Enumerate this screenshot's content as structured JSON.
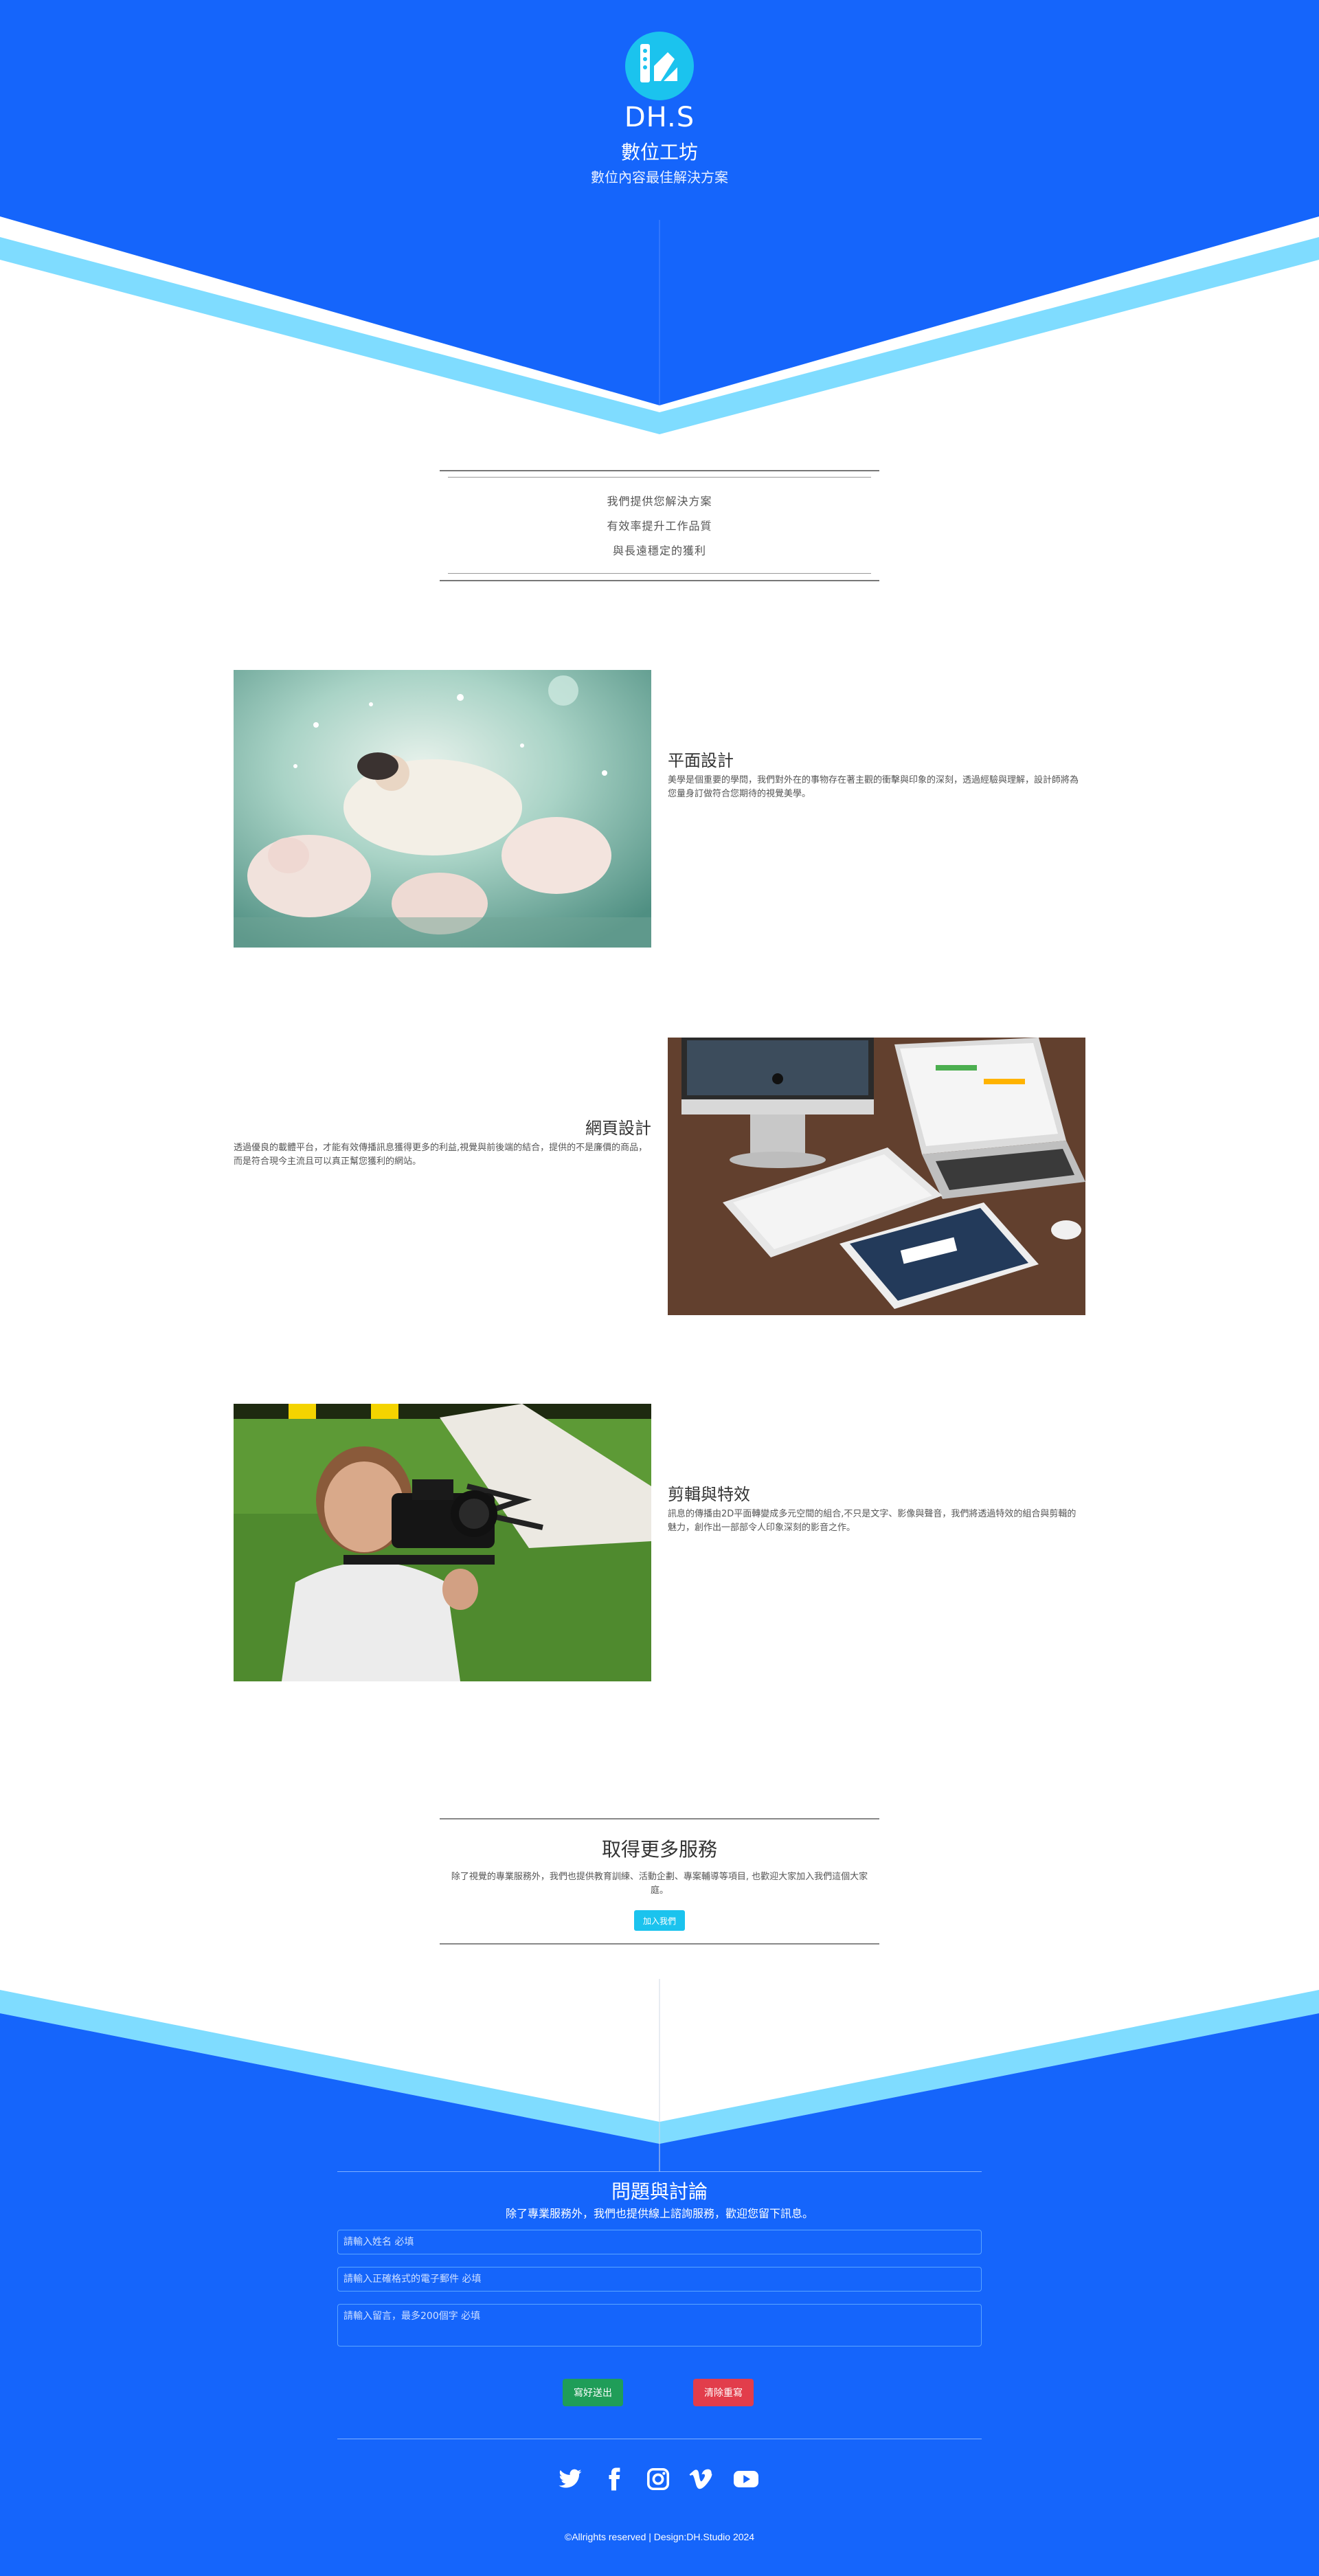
{
  "header": {
    "brand": "DH.S",
    "name": "數位工坊",
    "tagline": "數位內容最佳解決方案"
  },
  "intro": {
    "lines": [
      "我們提供您解決方案",
      "有效率提升工作品質",
      "與長遠穩定的獲利"
    ]
  },
  "services": [
    {
      "title": "平面設計",
      "desc": "美學是個重要的學問，我們對外在的事物存在著主觀的衝擊與印象的深刻，透過經驗與理解，設計師將為您量身訂做符合您期待的視覺美學。",
      "image": "fantasy-illustration"
    },
    {
      "title": "網頁設計",
      "desc": "透過優良的載體平台，才能有效傳播訊息獲得更多的利益,視覺與前後端的結合，提供的不是廉價的商品，而是符合現今主流且可以真正幫您獲利的網站。",
      "image": "devices-desk-photo"
    },
    {
      "title": "剪輯與特效",
      "desc": "訊息的傳播由2D平面轉變成多元空間的組合,不只是文字、影像與聲音，我們將透過特效的組合與剪輯的魅力，創作出一部部令人印象深刻的影音之作。",
      "image": "cameraman-photo"
    }
  ],
  "cta": {
    "title": "取得更多服務",
    "desc": "除了視覺的專業服務外，我們也提供教育訓練、活動企劃、專案輔導等項目, 也歡迎大家加入我們這個大家庭。",
    "button": "加入我們"
  },
  "contact": {
    "title": "問題與討論",
    "desc": "除了專業服務外，我們也提供線上諮詢服務，歡迎您留下訊息。",
    "name_placeholder": "請輸入姓名 必填",
    "email_placeholder": "請輸入正確格式的電子郵件 必填",
    "message_placeholder": "請輸入留言，最多200個字 必填",
    "submit": "寫好送出",
    "reset": "清除重寫"
  },
  "social": [
    "twitter-icon",
    "facebook-icon",
    "instagram-icon",
    "vimeo-icon",
    "youtube-icon"
  ],
  "footer": {
    "copyright": "©Allrights reserved | Design:DH.Studio 2024"
  },
  "colors": {
    "primary": "#1565fb",
    "accent": "#7fdcff",
    "badge": "#1bc3ee",
    "submit": "#1f9d58",
    "reset": "#e23d4b"
  }
}
